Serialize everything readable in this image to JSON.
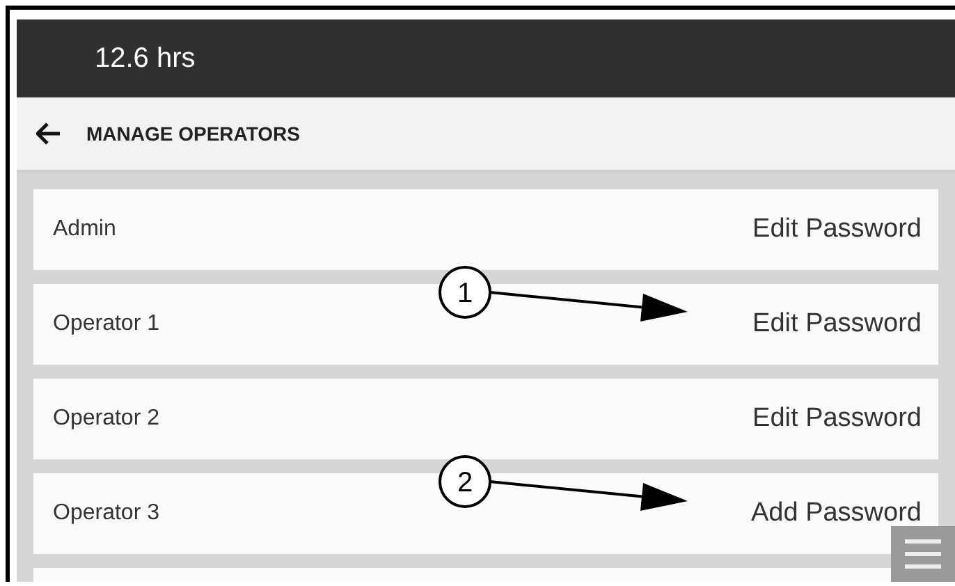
{
  "header": {
    "hours": "12.6 hrs"
  },
  "nav": {
    "title": "MANAGE OPERATORS"
  },
  "operators": [
    {
      "name": "Admin",
      "action": "Edit Password"
    },
    {
      "name": "Operator 1",
      "action": "Edit Password",
      "callout": "1"
    },
    {
      "name": "Operator 2",
      "action": "Edit Password"
    },
    {
      "name": "Operator 3",
      "action": "Add Password",
      "callout": "2"
    }
  ]
}
